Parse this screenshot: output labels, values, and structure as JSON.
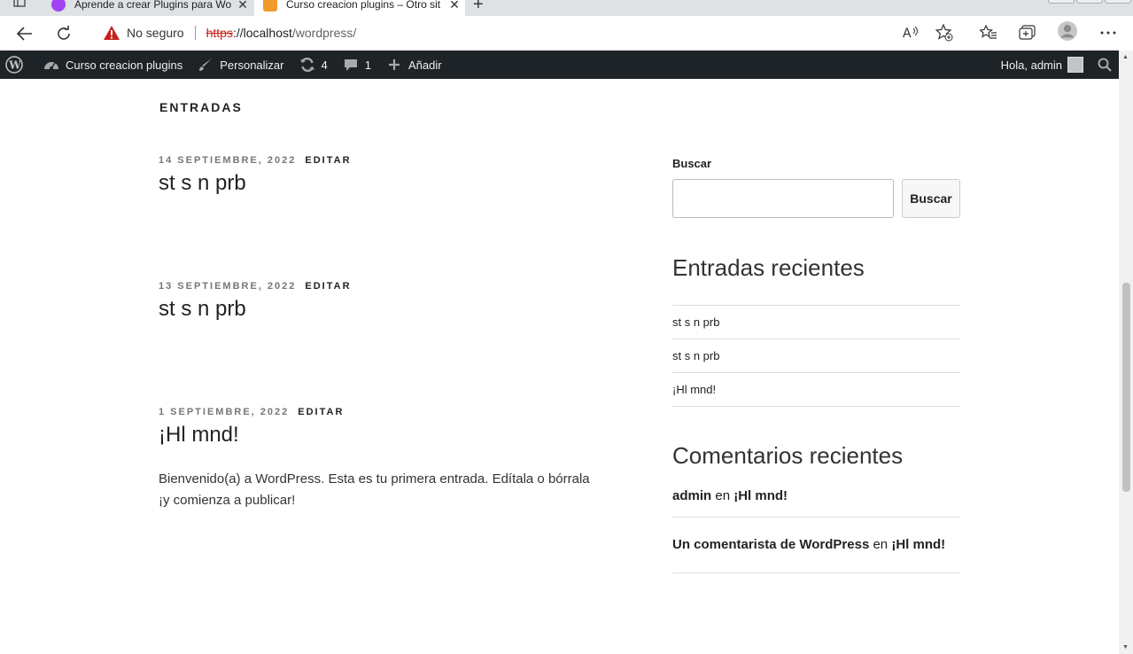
{
  "browser": {
    "tabs": [
      {
        "title": "Aprende a crear Plugins para Wo",
        "favicon_color": "#a142f4"
      },
      {
        "title": "Curso creacion plugins – Otro sit",
        "favicon_color": "#f29a2e"
      }
    ],
    "security_label": "No seguro",
    "url_scheme": "https",
    "url_separator": "://",
    "url_host": "localhost",
    "url_path": "/wordpress/"
  },
  "adminbar": {
    "site_name": "Curso creacion plugins",
    "customize": "Personalizar",
    "updates_count": "4",
    "comments_count": "1",
    "add_new": "Añadir",
    "greeting": "Hola, admin"
  },
  "main": {
    "section_title": "ENTRADAS",
    "posts": [
      {
        "date": "14 SEPTIEMBRE, 2022",
        "edit": "EDITAR",
        "title": "st s n prb",
        "excerpt": ""
      },
      {
        "date": "13 SEPTIEMBRE, 2022",
        "edit": "EDITAR",
        "title": "st s n prb",
        "excerpt": ""
      },
      {
        "date": "1 SEPTIEMBRE, 2022",
        "edit": "EDITAR",
        "title": "¡Hl mnd!",
        "excerpt": "Bienvenido(a) a WordPress. Esta es tu primera entrada. Edítala o bórrala ¡y comienza a publicar!"
      }
    ]
  },
  "sidebar": {
    "search_label": "Buscar",
    "search_button": "Buscar",
    "search_value": "",
    "recent_posts_title": "Entradas recientes",
    "recent_posts": [
      "st s n prb",
      "st s n prb",
      "¡Hl mnd!"
    ],
    "recent_comments_title": "Comentarios recientes",
    "recent_comments": [
      {
        "author": "admin",
        "connector": "en",
        "post": "¡Hl mnd!"
      },
      {
        "author": "Un comentarista de WordPress",
        "connector": "en",
        "post": "¡Hl mnd!"
      }
    ]
  }
}
